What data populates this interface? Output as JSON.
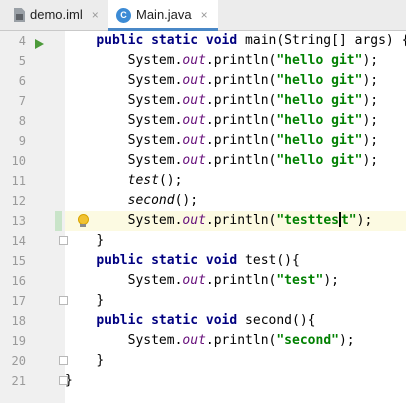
{
  "tabs": [
    {
      "label": "demo.iml",
      "close": "×",
      "icon": "iml-file-icon"
    },
    {
      "label": "Main.java",
      "close": "×",
      "icon": "java-class-icon",
      "class_letter": "C",
      "active": true
    }
  ],
  "gutter": {
    "line_numbers": [
      "4",
      "5",
      "6",
      "7",
      "8",
      "9",
      "10",
      "11",
      "12",
      "13",
      "14",
      "15",
      "16",
      "17",
      "18",
      "19",
      "20",
      "21"
    ]
  },
  "code": {
    "kw_public": "public",
    "kw_static": "static",
    "kw_void": "void",
    "main_sig_rest": " main(String[] args) {",
    "indent_body": "        ",
    "indent_method": "    ",
    "system": "System.",
    "out": "out",
    "println": ".println(",
    "str_hello": "\"hello git\"",
    "close_call": ");",
    "test_call": "test",
    "second_call": "second",
    "call_rest": "();",
    "str_testtest_a": "\"testtes",
    "str_testtest_b": "t\"",
    "close_brace": "}",
    "test_sig_rest": " test(){",
    "str_test": "\"test\"",
    "second_sig_rest": " second(){",
    "str_second": "\"second\"",
    "space": " "
  },
  "colors": {
    "keyword": "#000080",
    "string": "#008000",
    "field": "#660e7a",
    "current_line": "#fcfae2",
    "tab_underline": "#4a88c7"
  }
}
